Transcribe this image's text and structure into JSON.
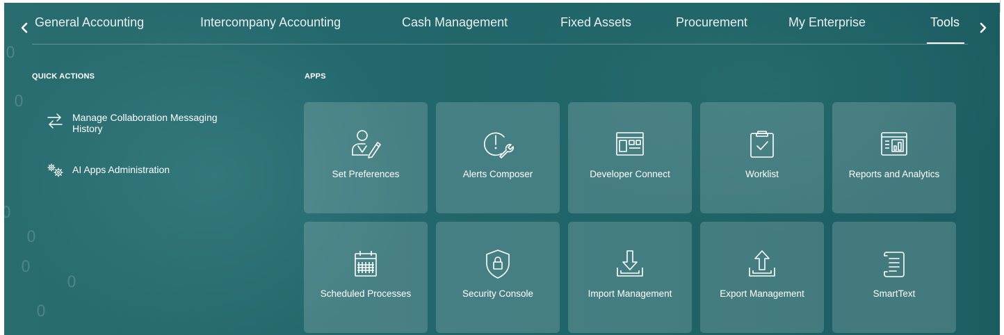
{
  "nav": {
    "prev_icon": "chevron-left-icon",
    "next_icon": "chevron-right-icon",
    "tabs": [
      {
        "label": "General Accounting"
      },
      {
        "label": "Intercompany Accounting"
      },
      {
        "label": "Cash Management"
      },
      {
        "label": "Fixed Assets"
      },
      {
        "label": "Procurement"
      },
      {
        "label": "My Enterprise"
      },
      {
        "label": "Tools",
        "active": true
      }
    ]
  },
  "quick_actions": {
    "title": "QUICK ACTIONS",
    "items": [
      {
        "label": "Manage Collaboration Messaging History",
        "icon": "swap-arrows-icon"
      },
      {
        "label": "AI Apps Administration",
        "icon": "gears-icon"
      }
    ]
  },
  "apps": {
    "title": "APPS",
    "tiles": [
      {
        "label": "Set Preferences",
        "icon": "user-edit-icon"
      },
      {
        "label": "Alerts Composer",
        "icon": "alert-wrench-icon"
      },
      {
        "label": "Developer Connect",
        "icon": "developer-window-icon"
      },
      {
        "label": "Worklist",
        "icon": "clipboard-check-icon"
      },
      {
        "label": "Reports and Analytics",
        "icon": "report-chart-icon"
      },
      {
        "label": "Scheduled Processes",
        "icon": "calendar-icon"
      },
      {
        "label": "Security Console",
        "icon": "shield-lock-icon"
      },
      {
        "label": "Import Management",
        "icon": "import-icon"
      },
      {
        "label": "Export Management",
        "icon": "export-icon"
      },
      {
        "label": "SmartText",
        "icon": "scroll-text-icon"
      }
    ]
  },
  "colors": {
    "background": "#23686c",
    "tile": "rgba(255,255,255,0.17)",
    "text": "#ffffff"
  }
}
